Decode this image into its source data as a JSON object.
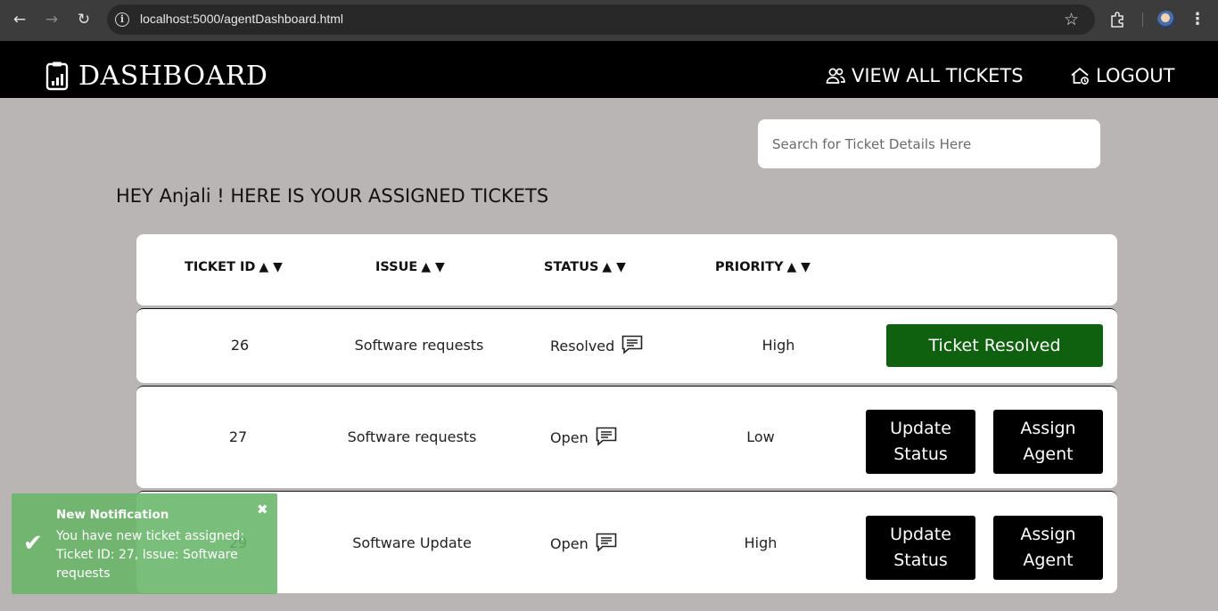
{
  "browser": {
    "url": "localhost:5000/agentDashboard.html",
    "back_icon": "back-arrow-icon",
    "forward_icon": "forward-arrow-icon",
    "reload_icon": "reload-icon"
  },
  "header": {
    "brand": "DASHBOARD",
    "view_all": "VIEW ALL TICKETS",
    "logout": "LOGOUT"
  },
  "search": {
    "placeholder": "Search for Ticket Details Here"
  },
  "greeting": "HEY Anjali ! HERE IS YOUR ASSIGNED TICKETS",
  "table": {
    "columns": [
      {
        "label": "TICKET ID",
        "sort": "▲ ▼"
      },
      {
        "label": "ISSUE",
        "sort": "▲ ▼"
      },
      {
        "label": "STATUS",
        "sort": "▲ ▼"
      },
      {
        "label": "PRIORITY",
        "sort": "▲ ▼"
      }
    ],
    "rows": [
      {
        "id": "26",
        "issue": "Software requests",
        "status": "Resolved",
        "priority": "High",
        "action": "Ticket Resolved"
      },
      {
        "id": "27",
        "issue": "Software requests",
        "status": "Open",
        "priority": "Low",
        "update": "Update Status",
        "assign": "Assign Agent"
      },
      {
        "id": "29",
        "issue": "Software Update",
        "status": "Open",
        "priority": "High",
        "update": "Update Status",
        "assign": "Assign Agent"
      }
    ]
  },
  "notification": {
    "title": "New Notification",
    "message": "You have new ticket assigned: Ticket ID: 27, Issue: Software requests",
    "check": "✔",
    "close": "✖"
  },
  "colors": {
    "background": "#bab5b5",
    "header": "#000000",
    "resolved_button": "#0f6110",
    "toast": "#66b568"
  }
}
